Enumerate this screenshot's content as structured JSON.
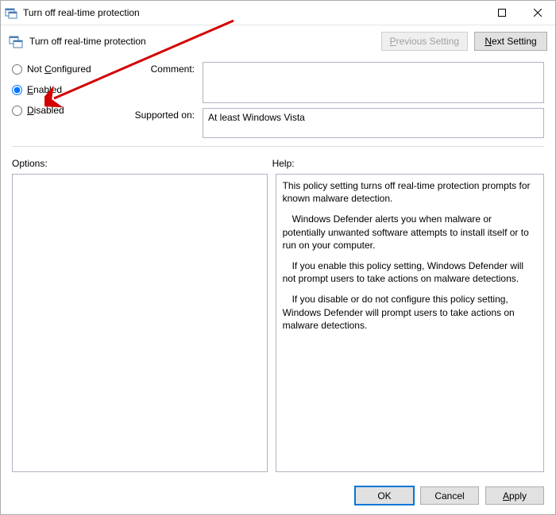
{
  "window": {
    "title": "Turn off real-time protection"
  },
  "header": {
    "title": "Turn off real-time protection",
    "prev_prefix": "P",
    "prev_rest": "revious Setting",
    "next_prefix": "N",
    "next_rest": "ext Setting"
  },
  "config": {
    "not_configured_prefix": "Not ",
    "not_configured_u": "C",
    "not_configured_rest": "onfigured",
    "enabled_u": "E",
    "enabled_rest": "nabled",
    "disabled_u": "D",
    "disabled_rest": "isabled",
    "selected": "enabled"
  },
  "form": {
    "comment_label": "Comment:",
    "comment_value": "",
    "supported_label": "Supported on:",
    "supported_value": "At least Windows Vista"
  },
  "panes": {
    "options_label": "Options:",
    "help_label": "Help:",
    "help_p1": "This policy setting turns off real-time protection prompts for known malware detection.",
    "help_p2": "Windows Defender alerts you when malware or potentially unwanted software attempts to install itself or to run on your computer.",
    "help_p3": "If you enable this policy setting, Windows Defender will not prompt users to take actions on malware detections.",
    "help_p4": "If you disable or do not configure this policy setting, Windows Defender will prompt users to take actions on malware detections."
  },
  "footer": {
    "ok": "OK",
    "cancel": "Cancel",
    "apply_u": "A",
    "apply_rest": "pply"
  }
}
